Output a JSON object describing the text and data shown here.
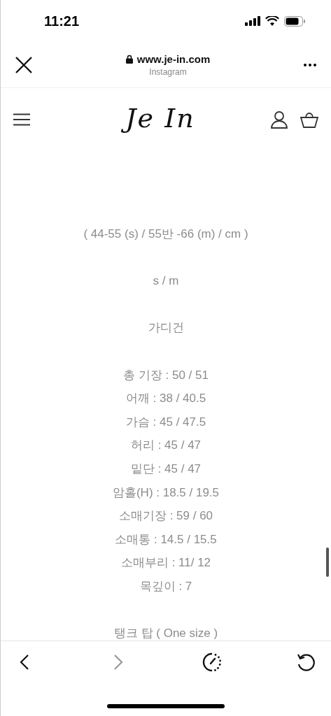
{
  "status_bar": {
    "time": "11:21"
  },
  "browser_bar": {
    "url": "www.je-in.com",
    "subtitle": "Instagram"
  },
  "site_header": {
    "logo": "Je In"
  },
  "content": {
    "blocks": [
      [
        "( 44-55 (s) / 55반 -66 (m) / cm )"
      ],
      [
        "s / m"
      ],
      [
        "가디건"
      ],
      [
        "총 기장 : 50 / 51",
        "어깨 : 38 / 40.5",
        "가슴 : 45 / 47.5",
        "허리 : 45 / 47",
        "밑단 : 45 / 47",
        "암홀(H) : 18.5 / 19.5",
        "소매기장 : 59 / 60",
        "소매통 : 14.5 / 15.5",
        "소매부리 : 11/ 12",
        "목깊이 : 7"
      ],
      [
        "탱크 탑 ( One size )"
      ]
    ]
  },
  "toolbar": {
    "buttons": [
      {
        "kind": "back",
        "disabled": false
      },
      {
        "kind": "forward",
        "disabled": true
      },
      {
        "kind": "speed",
        "disabled": false
      },
      {
        "kind": "reload",
        "disabled": false
      }
    ]
  }
}
